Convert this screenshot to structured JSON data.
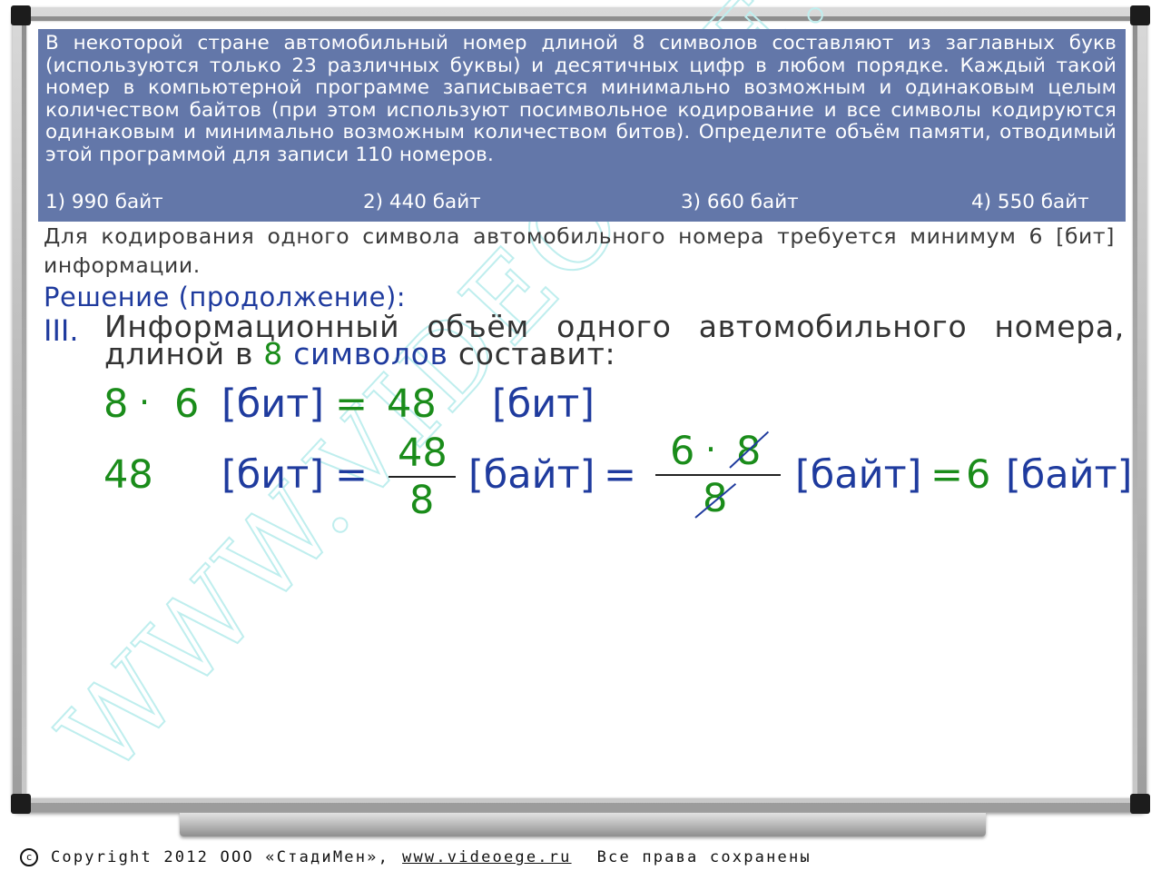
{
  "task": {
    "text": "В некоторой стране автомобильный номер длиной 8 символов составляют из заглавных букв (используются только 23 различных буквы) и десятичных цифр в любом порядке. Каждый такой номер в компьютерной программе записывается минимально возможным и одинаковым целым количеством байтов (при этом используют посимвольное кодирование и все символы кодируются одинаковым и минимально возможным количеством битов). Определите объём памяти, отводимый этой программой для записи 110 номеров.",
    "answers": [
      "1) 990 байт",
      "2) 440 байт",
      "3) 660 байт",
      "4) 550 байт"
    ]
  },
  "note": "Для кодирования одного символа автомобильного номера требуется минимум 6 [бит] информации.",
  "solution": {
    "title": "Решение (продолжение):",
    "step_number": "III.",
    "line1": [
      "Информационный",
      "объём",
      "одного",
      "автомобильного",
      "номера,"
    ],
    "line2_prefix": "длиной в ",
    "line2_num": "8",
    "line2_word": " символов",
    "line2_suffix": " составит:"
  },
  "math": {
    "eq1_a": "8",
    "eq1_dot": "·",
    "eq1_b": "6",
    "eq1_unit": "[бит]",
    "eq1_eq": "=",
    "eq1_result": "48",
    "eq1_result_unit": "[бит]",
    "eq2_value": "48",
    "eq2_unit": "[бит]",
    "eq2_eq1": "=",
    "eq2_frac_num": "48",
    "eq2_frac_den": "8",
    "eq2_unit2": "[байт]",
    "eq2_eq2": "=",
    "eq2_frac2_num_a": "6",
    "eq2_frac2_dot": "·",
    "eq2_frac2_num_b": "8",
    "eq2_frac2_den": "8",
    "eq2_unit3": "[байт]",
    "eq2_eq3": "=",
    "eq2_result": "6",
    "eq2_result_unit": "[байт]"
  },
  "watermark": "WWW.VIDEOEGE.RU",
  "footer": {
    "icon": "c",
    "copyright": "Copyright 2012 ООО «СтадиМен»,",
    "site": "www.videoege.ru",
    "rights": "Все права сохранены"
  },
  "colors": {
    "task_bg": "#6377a9",
    "green": "#1a8c1a",
    "blue": "#1f3b9e",
    "watermark": "#bfeeee"
  }
}
